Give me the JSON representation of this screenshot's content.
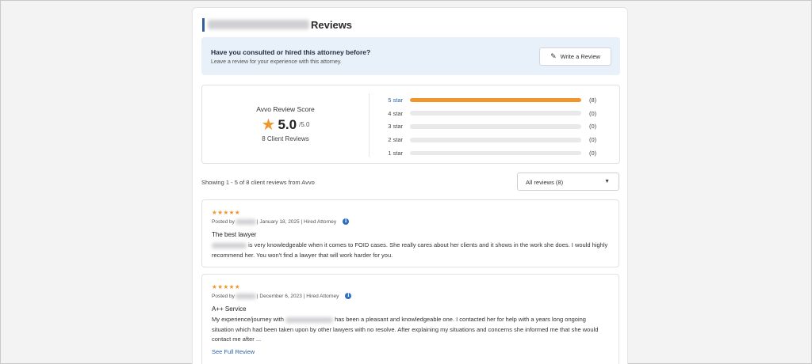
{
  "header": {
    "title_suffix": "Reviews"
  },
  "consult": {
    "question": "Have you consulted or hired this attorney before?",
    "subtext": "Leave a review for your experience with this attorney.",
    "write_button": "Write a Review",
    "write_icon": "pencil-icon"
  },
  "score": {
    "title": "Avvo Review Score",
    "value": "5.0",
    "max": "/5.0",
    "client_reviews": "8 Client Reviews",
    "star_color": "#f0962b",
    "ratings": [
      {
        "label": "5 star",
        "count": "(8)",
        "fraction": 1.0
      },
      {
        "label": "4 star",
        "count": "(0)",
        "fraction": 0
      },
      {
        "label": "3 star",
        "count": "(0)",
        "fraction": 0
      },
      {
        "label": "2 star",
        "count": "(0)",
        "fraction": 0
      },
      {
        "label": "1 star",
        "count": "(0)",
        "fraction": 0
      }
    ]
  },
  "list": {
    "showing": "Showing 1 - 5 of 8 client reviews from Avvo",
    "filter_selected": "All reviews (8)"
  },
  "reviews": [
    {
      "stars": "★★★★★",
      "posted_prefix": "Posted by",
      "posted_suffix": "| January 18, 2025 | Hired Attorney",
      "title": "The best lawyer",
      "body": "is very knowledgeable when it comes to FOID cases. She really cares about her clients and it shows in the work she does. I would highly recommend her. You won't find a lawyer that will work harder for you."
    },
    {
      "stars": "★★★★★",
      "posted_prefix": "Posted by",
      "posted_suffix": "| December 6, 2023 | Hired Attorney",
      "title": "A++ Service",
      "body_before": "My experience/journey with",
      "body_after": "has been a pleasant and knowledgeable one. I contacted her for help with a years long ongoing situation which had been taken upon by other lawyers with no resolve. After explaining my situations and concerns she informed me that she would contact me after ...",
      "see_full": "See Full Review"
    }
  ]
}
